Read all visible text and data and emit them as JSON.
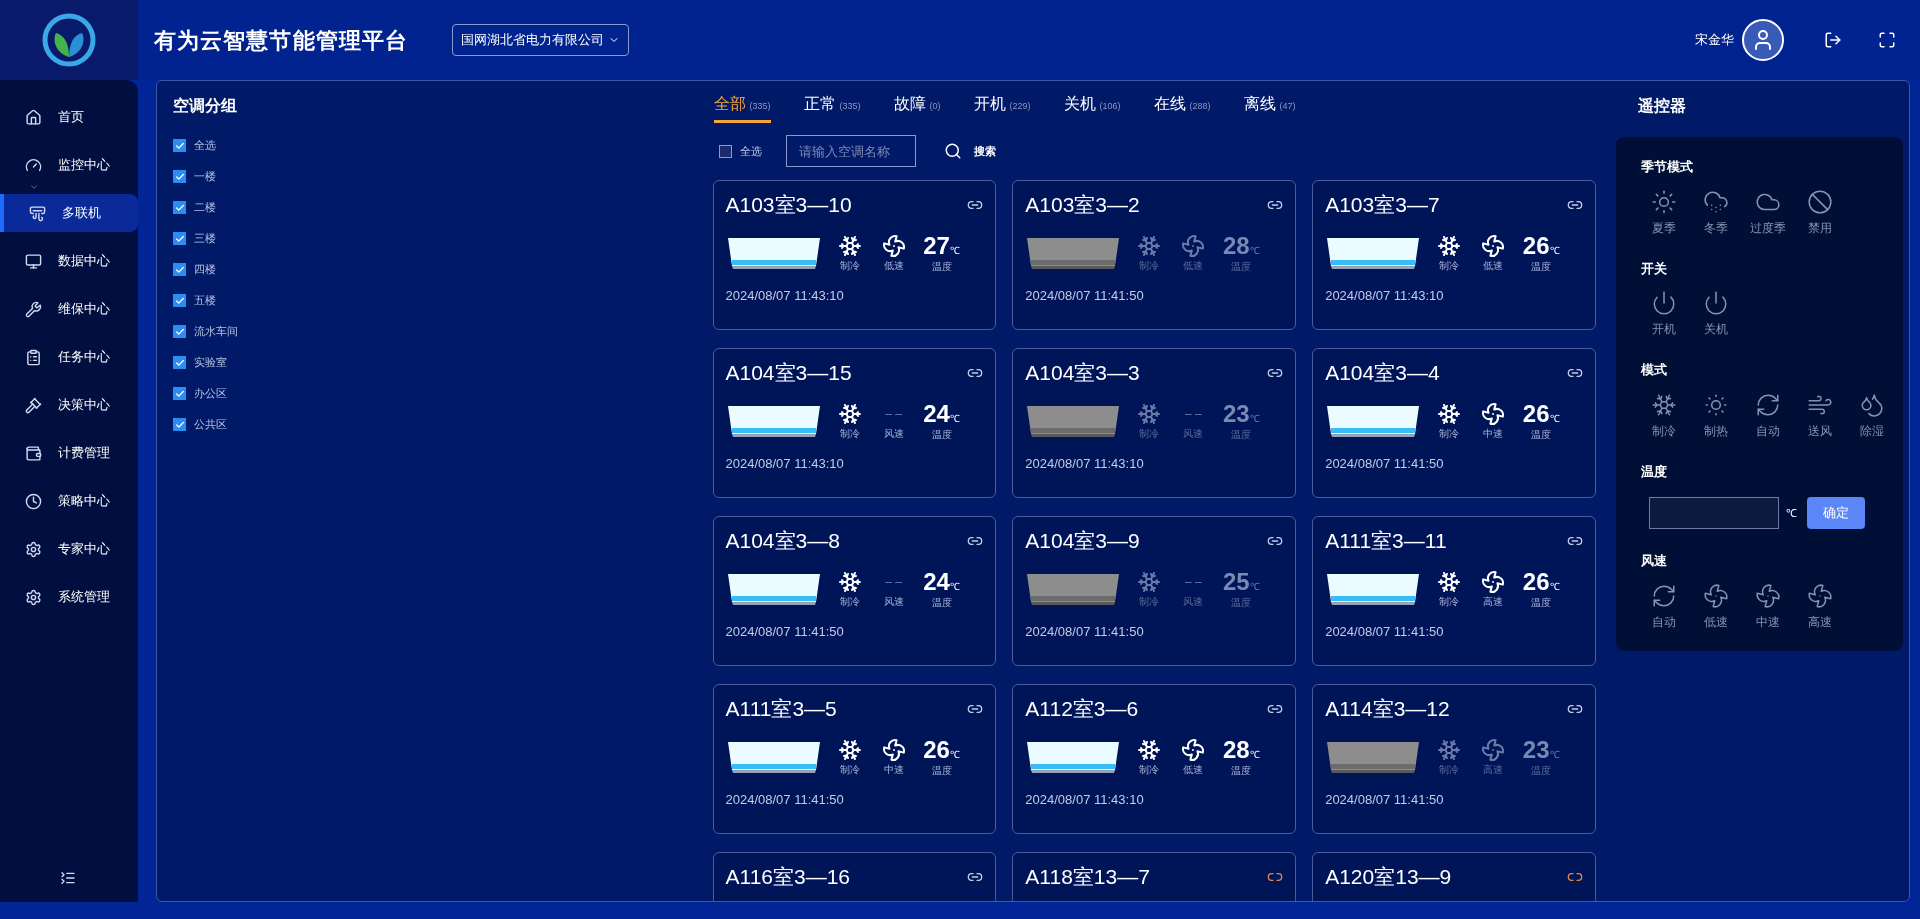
{
  "header": {
    "title": "有为云智慧节能管理平台",
    "company": "国网湖北省电力有限公司",
    "user": "宋金华"
  },
  "sidebar": {
    "items": [
      {
        "label": "首页",
        "selected": false,
        "expandable": false
      },
      {
        "label": "监控中心",
        "selected": false,
        "expandable": true
      },
      {
        "label": "多联机",
        "selected": true,
        "expandable": false
      },
      {
        "label": "数据中心",
        "selected": false,
        "expandable": false
      },
      {
        "label": "维保中心",
        "selected": false,
        "expandable": false
      },
      {
        "label": "任务中心",
        "selected": false,
        "expandable": false
      },
      {
        "label": "决策中心",
        "selected": false,
        "expandable": false
      },
      {
        "label": "计费管理",
        "selected": false,
        "expandable": false
      },
      {
        "label": "策略中心",
        "selected": false,
        "expandable": false
      },
      {
        "label": "专家中心",
        "selected": false,
        "expandable": false
      },
      {
        "label": "系统管理",
        "selected": false,
        "expandable": false
      }
    ]
  },
  "groups": {
    "title": "空调分组",
    "items": [
      {
        "label": "全选",
        "checked": true
      },
      {
        "label": "一楼",
        "checked": true
      },
      {
        "label": "二楼",
        "checked": true
      },
      {
        "label": "三楼",
        "checked": true
      },
      {
        "label": "四楼",
        "checked": true
      },
      {
        "label": "五楼",
        "checked": true
      },
      {
        "label": "流水车间",
        "checked": true
      },
      {
        "label": "实验室",
        "checked": true
      },
      {
        "label": "办公区",
        "checked": true
      },
      {
        "label": "公共区",
        "checked": true
      }
    ]
  },
  "tabs": [
    {
      "label": "全部",
      "count": "(335)",
      "selected": true
    },
    {
      "label": "正常",
      "count": "(335)",
      "selected": false
    },
    {
      "label": "故障",
      "count": "(0)",
      "selected": false
    },
    {
      "label": "开机",
      "count": "(229)",
      "selected": false
    },
    {
      "label": "关机",
      "count": "(106)",
      "selected": false
    },
    {
      "label": "在线",
      "count": "(288)",
      "selected": false
    },
    {
      "label": "离线",
      "count": "(47)",
      "selected": false
    }
  ],
  "filter": {
    "select_all": "全选",
    "checked": false,
    "placeholder": "请输入空调名称",
    "search": "搜索"
  },
  "units": [
    {
      "name": "A103室3—10",
      "linked": true,
      "on": true,
      "mode": "制冷",
      "speed": "低速",
      "temp": "27",
      "unit": "℃",
      "temp_label": "温度",
      "time": "2024/08/07 11:43:10"
    },
    {
      "name": "A103室3—2",
      "linked": true,
      "on": false,
      "mode": "制冷",
      "speed": "低速",
      "temp": "28",
      "unit": "℃",
      "temp_label": "温度",
      "time": "2024/08/07 11:41:50"
    },
    {
      "name": "A103室3—7",
      "linked": true,
      "on": true,
      "mode": "制冷",
      "speed": "低速",
      "temp": "26",
      "unit": "℃",
      "temp_label": "温度",
      "time": "2024/08/07 11:43:10"
    },
    {
      "name": "A104室3—15",
      "linked": true,
      "on": true,
      "mode": "制冷",
      "speed": "风速",
      "speed_symbol": "– –",
      "temp": "24",
      "unit": "℃",
      "temp_label": "温度",
      "time": "2024/08/07 11:43:10"
    },
    {
      "name": "A104室3—3",
      "linked": true,
      "on": false,
      "mode": "制冷",
      "speed": "风速",
      "speed_symbol": "– –",
      "temp": "23",
      "unit": "℃",
      "temp_label": "温度",
      "time": "2024/08/07 11:43:10"
    },
    {
      "name": "A104室3—4",
      "linked": true,
      "on": true,
      "mode": "制冷",
      "speed": "中速",
      "temp": "26",
      "unit": "℃",
      "temp_label": "温度",
      "time": "2024/08/07 11:41:50"
    },
    {
      "name": "A104室3—8",
      "linked": true,
      "on": true,
      "mode": "制冷",
      "speed": "风速",
      "speed_symbol": "– –",
      "temp": "24",
      "unit": "℃",
      "temp_label": "温度",
      "time": "2024/08/07 11:41:50"
    },
    {
      "name": "A104室3—9",
      "linked": true,
      "on": false,
      "mode": "制冷",
      "speed": "风速",
      "speed_symbol": "– –",
      "temp": "25",
      "unit": "℃",
      "temp_label": "温度",
      "time": "2024/08/07 11:41:50"
    },
    {
      "name": "A111室3—11",
      "linked": true,
      "on": true,
      "mode": "制冷",
      "speed": "高速",
      "temp": "26",
      "unit": "℃",
      "temp_label": "温度",
      "time": "2024/08/07 11:41:50"
    },
    {
      "name": "A111室3—5",
      "linked": true,
      "on": true,
      "mode": "制冷",
      "speed": "中速",
      "temp": "26",
      "unit": "℃",
      "temp_label": "温度",
      "time": "2024/08/07 11:41:50"
    },
    {
      "name": "A112室3—6",
      "linked": true,
      "on": true,
      "mode": "制冷",
      "speed": "低速",
      "temp": "28",
      "unit": "℃",
      "temp_label": "温度",
      "time": "2024/08/07 11:43:10"
    },
    {
      "name": "A114室3—12",
      "linked": true,
      "on": false,
      "mode": "制冷",
      "speed": "高速",
      "temp": "23",
      "unit": "℃",
      "temp_label": "温度",
      "time": "2024/08/07 11:41:50"
    },
    {
      "name": "A116室3—16",
      "linked": true
    },
    {
      "name": "A118室13—7",
      "linked": false
    },
    {
      "name": "A120室13—9",
      "linked": false
    }
  ],
  "remote": {
    "title": "遥控器",
    "sections": [
      {
        "title": "季节模式",
        "kind": "icons",
        "items": [
          {
            "label": "夏季"
          },
          {
            "label": "冬季"
          },
          {
            "label": "过度季"
          },
          {
            "label": "禁用"
          }
        ]
      },
      {
        "title": "开关",
        "kind": "icons",
        "items": [
          {
            "label": "开机"
          },
          {
            "label": "关机"
          }
        ]
      },
      {
        "title": "模式",
        "kind": "icons",
        "items": [
          {
            "label": "制冷"
          },
          {
            "label": "制热"
          },
          {
            "label": "自动"
          },
          {
            "label": "送风"
          },
          {
            "label": "除湿"
          }
        ]
      },
      {
        "title": "温度",
        "kind": "input",
        "unit": "℃",
        "button": "确定"
      },
      {
        "title": "风速",
        "kind": "icons",
        "items": [
          {
            "label": "自动"
          },
          {
            "label": "低速"
          },
          {
            "label": "中速"
          },
          {
            "label": "高速"
          }
        ]
      }
    ]
  }
}
